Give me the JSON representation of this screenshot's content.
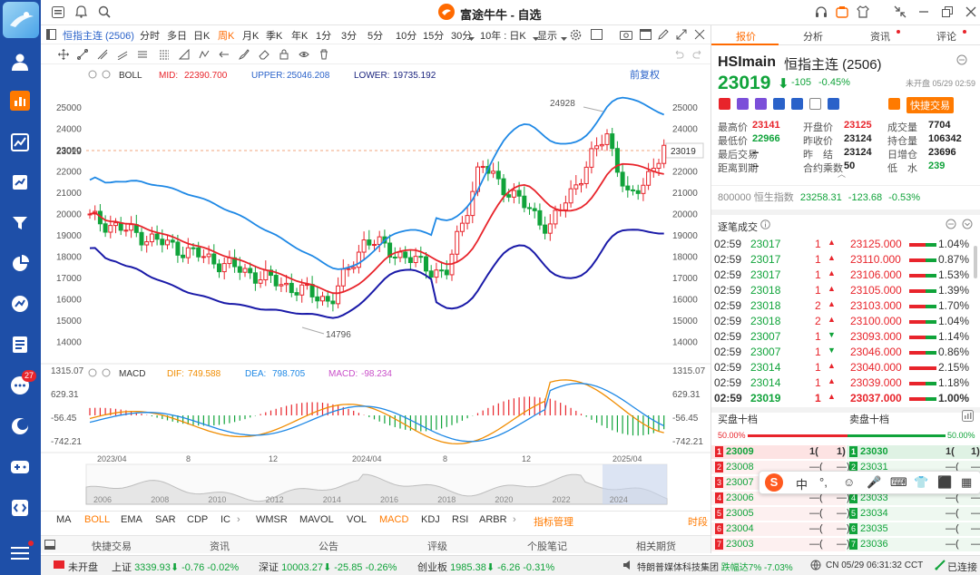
{
  "app": {
    "title": "富途牛牛 - 自选"
  },
  "sidebar": {
    "badge": "27"
  },
  "toolbar1": {
    "contract": "恒指主连 (2506)",
    "periods": [
      "分时",
      "多日",
      "日K",
      "周K",
      "月K",
      "季K",
      "年K",
      "1分",
      "3分",
      "5分",
      "10分",
      "15分",
      "30分"
    ],
    "active_period": "周K",
    "range": "10年 : 日K",
    "display": "显示"
  },
  "toolbar2": {
    "fuquan": "前复权"
  },
  "boll": {
    "name": "BOLL",
    "mid_label": "MID:",
    "mid": "22390.700",
    "upper_label": "UPPER:",
    "upper": "25046.208",
    "lower_label": "LOWER:",
    "lower": "19735.192"
  },
  "macd": {
    "name": "MACD",
    "dif_label": "DIF:",
    "dif": "749.588",
    "dea_label": "DEA:",
    "dea": "798.705",
    "macd_label": "MACD:",
    "macd": "-98.234"
  },
  "price_axis": {
    "ticks": [
      "25000",
      "24000",
      "23000",
      "22000",
      "21000",
      "20000",
      "19000",
      "18000",
      "17000",
      "16000",
      "15000",
      "14000"
    ],
    "current": "23019",
    "high_mark": "24928",
    "low_mark": "14796"
  },
  "macd_axis": {
    "ticks": [
      "1315.07",
      "629.31",
      "-56.45",
      "-742.21"
    ]
  },
  "time_axis": {
    "labels": [
      "2023/04",
      "8",
      "12",
      "2024/04",
      "8",
      "12",
      "2025/04"
    ]
  },
  "overview_axis": {
    "labels": [
      "2006",
      "2008",
      "2010",
      "2012",
      "2014",
      "2016",
      "2018",
      "2020",
      "2022",
      "2024"
    ]
  },
  "indicators": {
    "main": [
      "MA",
      "BOLL",
      "EMA",
      "SAR",
      "CDP",
      "IC"
    ],
    "active_main": "BOLL",
    "sub": [
      "WMSR",
      "MAVOL",
      "VOL",
      "MACD",
      "KDJ",
      "RSI",
      "ARBR"
    ],
    "active_sub": "MACD",
    "manage": "指标管理",
    "time": "时段"
  },
  "info_tabs": [
    "快捷交易",
    "资讯",
    "公告",
    "评级",
    "个股笔记",
    "相关期货"
  ],
  "right": {
    "tabs": [
      "报价",
      "分析",
      "资讯",
      "评论"
    ],
    "symbol": "HSImain",
    "name": "恒指主连 (2506)",
    "price": "23019",
    "arrow": "⬇",
    "change": "-105",
    "change_pct": "-0.45%",
    "status": "未开盘 05/29 02:59",
    "quick_trade": "快捷交易",
    "stats": [
      [
        {
          "k": "最高价",
          "v": "23141",
          "c": "red"
        },
        {
          "k": "开盘价",
          "v": "23125",
          "c": "red"
        },
        {
          "k": "成交量",
          "v": "7704",
          "c": "dark"
        }
      ],
      [
        {
          "k": "最低价",
          "v": "22966",
          "c": "green"
        },
        {
          "k": "昨收价",
          "v": "23124",
          "c": "dark"
        },
        {
          "k": "持仓量",
          "v": "106342",
          "c": "dark"
        }
      ],
      [
        {
          "k": "最后交易",
          "v": "--",
          "c": "dark"
        },
        {
          "k": "昨　结",
          "v": "23124",
          "c": "dark"
        },
        {
          "k": "日增仓",
          "v": "23696",
          "c": "dark"
        }
      ],
      [
        {
          "k": "距离到期",
          "v": "--",
          "c": "dark"
        },
        {
          "k": "合约乘数",
          "v": "50",
          "c": "dark"
        },
        {
          "k": "低　水",
          "v": "239",
          "c": "green"
        }
      ]
    ],
    "index": {
      "code": "800000",
      "name": "恒生指数",
      "value": "23258.31",
      "chg": "-123.68",
      "pct": "-0.53%"
    },
    "ticks_title": "逐笔成交",
    "ticks": [
      {
        "t": "02:59",
        "p": "23017",
        "v": "1",
        "d": "up",
        "p2": "23125.000",
        "pct": "1.04%",
        "c": "green"
      },
      {
        "t": "02:59",
        "p": "23017",
        "v": "1",
        "d": "up",
        "p2": "23110.000",
        "pct": "0.87%",
        "c": "green"
      },
      {
        "t": "02:59",
        "p": "23017",
        "v": "1",
        "d": "up",
        "p2": "23106.000",
        "pct": "1.53%",
        "c": "green"
      },
      {
        "t": "02:59",
        "p": "23018",
        "v": "1",
        "d": "up",
        "p2": "23105.000",
        "pct": "1.39%",
        "c": "green"
      },
      {
        "t": "02:59",
        "p": "23018",
        "v": "2",
        "d": "up",
        "p2": "23103.000",
        "pct": "1.70%",
        "c": "green"
      },
      {
        "t": "02:59",
        "p": "23018",
        "v": "2",
        "d": "up",
        "p2": "23100.000",
        "pct": "1.04%",
        "c": "green"
      },
      {
        "t": "02:59",
        "p": "23007",
        "v": "1",
        "d": "down",
        "p2": "23093.000",
        "pct": "1.14%",
        "c": "green"
      },
      {
        "t": "02:59",
        "p": "23007",
        "v": "1",
        "d": "down",
        "p2": "23046.000",
        "pct": "0.86%",
        "c": "green"
      },
      {
        "t": "02:59",
        "p": "23014",
        "v": "1",
        "d": "up",
        "p2": "23040.000",
        "pct": "2.15%",
        "c": "red"
      },
      {
        "t": "02:59",
        "p": "23014",
        "v": "1",
        "d": "up",
        "p2": "23039.000",
        "pct": "1.18%",
        "c": "green"
      },
      {
        "t": "02:59",
        "p": "23019",
        "v": "1",
        "d": "up",
        "p2": "23037.000",
        "pct": "1.00%",
        "c": "green"
      }
    ],
    "book": {
      "buy_title": "买盘十档",
      "sell_title": "卖盘十档",
      "buy_pct": "50.00%",
      "sell_pct": "50.00%",
      "rows": [
        {
          "n": "1",
          "b": "23009",
          "bv": "1(",
          "bo": "1)",
          "s": "23030",
          "sv": "1(",
          "so": "1)"
        },
        {
          "n": "2",
          "b": "23008",
          "bv": "—(",
          "bo": "—)",
          "s": "23031",
          "sv": "—(",
          "so": "—)"
        },
        {
          "n": "3",
          "b": "23007",
          "bv": "—(",
          "bo": "—)",
          "s": "23032",
          "sv": "—(",
          "so": "—)"
        },
        {
          "n": "4",
          "b": "23006",
          "bv": "—(",
          "bo": "—)",
          "s": "23033",
          "sv": "—(",
          "so": "—)"
        },
        {
          "n": "5",
          "b": "23005",
          "bv": "—(",
          "bo": "—)",
          "s": "23034",
          "sv": "—(",
          "so": "—)"
        },
        {
          "n": "6",
          "b": "23004",
          "bv": "—(",
          "bo": "—)",
          "s": "23035",
          "sv": "—(",
          "so": "—)"
        },
        {
          "n": "7",
          "b": "23003",
          "bv": "—(",
          "bo": "—)",
          "s": "23036",
          "sv": "—(",
          "so": "—)"
        }
      ]
    },
    "ime": [
      "中",
      "°,",
      "☺",
      "🎤",
      "⌨",
      "👕",
      "⬛",
      "▦"
    ]
  },
  "status": {
    "market": "未开盘",
    "sh_label": "上证",
    "sh": "3339.93",
    "sh_arrow": "⬇",
    "sh_chg": "-0.76",
    "sh_pct": "-0.02%",
    "sz_label": "深证",
    "sz": "10003.27",
    "sz_arrow": "⬇",
    "sz_chg": "-25.85",
    "sz_pct": "-0.26%",
    "cy_label": "创业板",
    "cy": "1985.38",
    "cy_arrow": "⬇",
    "cy_chg": "-6.26",
    "cy_pct": "-0.31%",
    "news": "特朗普媒体科技集团",
    "news_move": "跌幅达7%",
    "news_pct": "-7.03%",
    "clock": "CN 05/29 06:31:32 CCT",
    "conn": "已连接"
  }
}
